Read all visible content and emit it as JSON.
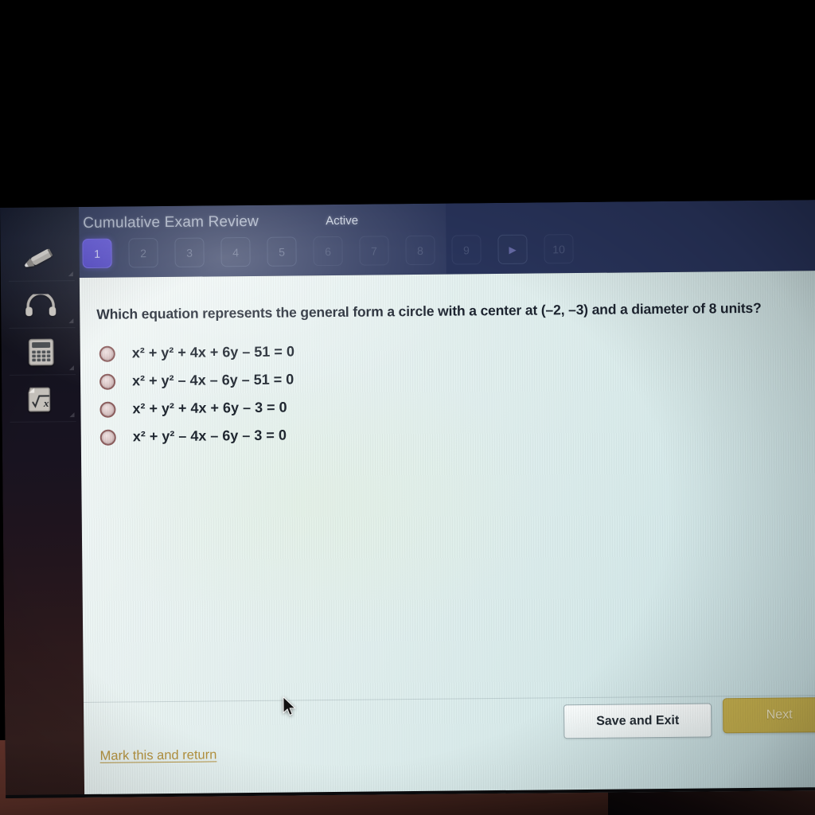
{
  "header": {
    "title": "Cumulative Exam Review",
    "status": "Active",
    "question_buttons": [
      {
        "label": "1",
        "state": "active"
      },
      {
        "label": "2",
        "state": "inactive"
      },
      {
        "label": "3",
        "state": "inactive"
      },
      {
        "label": "4",
        "state": "inactive"
      },
      {
        "label": "5",
        "state": "inactive"
      },
      {
        "label": "6",
        "state": "inactive"
      },
      {
        "label": "7",
        "state": "inactive"
      },
      {
        "label": "8",
        "state": "inactive"
      },
      {
        "label": "9",
        "state": "inactive"
      },
      {
        "label": "▶",
        "state": "arrow"
      },
      {
        "label": "10",
        "state": "inactive"
      }
    ]
  },
  "sidebar": {
    "tools": [
      {
        "name": "highlighter-icon",
        "label": "Highlighter"
      },
      {
        "name": "headphones-icon",
        "label": "Text to speech"
      },
      {
        "name": "calculator-icon",
        "label": "Calculator"
      },
      {
        "name": "formula-sheet-icon",
        "label": "Formula sheet"
      }
    ]
  },
  "main": {
    "question": "Which equation represents the general form a circle with a center at (–2, –3) and a diameter of 8 units?",
    "options": [
      {
        "id": "a",
        "text": "x² + y² + 4x + 6y – 51 = 0",
        "selected": false
      },
      {
        "id": "b",
        "text": "x² + y² – 4x – 6y – 51 = 0",
        "selected": false
      },
      {
        "id": "c",
        "text": "x² + y² + 4x + 6y – 3 = 0",
        "selected": false
      },
      {
        "id": "d",
        "text": "x² + y² – 4x – 6y – 3 = 0",
        "selected": false
      }
    ]
  },
  "footer": {
    "save_and_exit": "Save and Exit",
    "next": "Next",
    "mark_and_return": "Mark this and return"
  },
  "colors": {
    "header_blue": "#28335a",
    "active_question_button": "#4a3fc6",
    "next_button": "#c8b24f",
    "link_gold": "#b4923f",
    "content_background": "#e2efee",
    "rail_dark": "#13131f"
  }
}
